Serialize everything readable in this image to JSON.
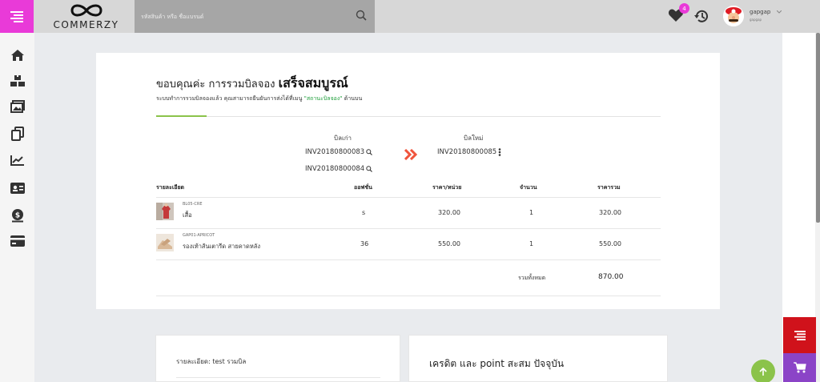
{
  "header": {
    "logo_text": "COMMERZY",
    "search_placeholder": "รหัสสินค้า หรือ ชื่อแบรนด์",
    "wishlist_count": "4",
    "user_name": "gapgap",
    "user_sub": "gapgap"
  },
  "sidebar": {
    "items": [
      "home-icon",
      "boxes-icon",
      "images-icon",
      "copy-icon",
      "chart-icon",
      "id-card-icon",
      "money-icon",
      "credit-card-icon"
    ]
  },
  "main": {
    "title_prefix": "ขอบคุณค่ะ การรวมบิลจอง",
    "title_bold": "เสร็จสมบูรณ์",
    "subtitle_before": "ระบบทำการรวมบิลจองแล้ว คุณสามารถยืนยันการส่งได้ที่เมนู ",
    "subtitle_highlight": "\"สถานะบิลจอง\"",
    "subtitle_after": " ด้านบน",
    "old_bill_label": "บิลเก่า",
    "new_bill_label": "บิลใหม่",
    "old_bills": [
      "INV20180800083",
      "INV20180800084"
    ],
    "new_bill": "INV20180800085",
    "table": {
      "headers": [
        "รายละเอียด",
        "ออฟชั่น",
        "ราคา/หน่วย",
        "จำนวน",
        "ราคารวม"
      ],
      "rows": [
        {
          "sku": "BL05-CRE",
          "name": "เสื้อ",
          "option": "s",
          "unit_price": "320.00",
          "qty": "1",
          "total": "320.00"
        },
        {
          "sku": "GAP01-APRICOT",
          "name": "รองเท้าส้นเตารีด สายคาดหลัง",
          "option": "36",
          "unit_price": "550.00",
          "qty": "1",
          "total": "550.00"
        }
      ],
      "grand_total_label": "รวมทั้งหมด",
      "grand_total": "870.00"
    }
  },
  "bottom": {
    "detail_text": "รายละเอียด: test รวมบิล",
    "credit_title": "เครดิต และ point สะสม ปัจจุบัน"
  },
  "colors": {
    "accent_pink": "#e93ad8",
    "accent_green": "#8bc34a",
    "highlight_green": "#1e9e3a",
    "arrow_red": "#f0543c",
    "float_red": "#d0121b",
    "float_purple": "#8b44c7"
  }
}
